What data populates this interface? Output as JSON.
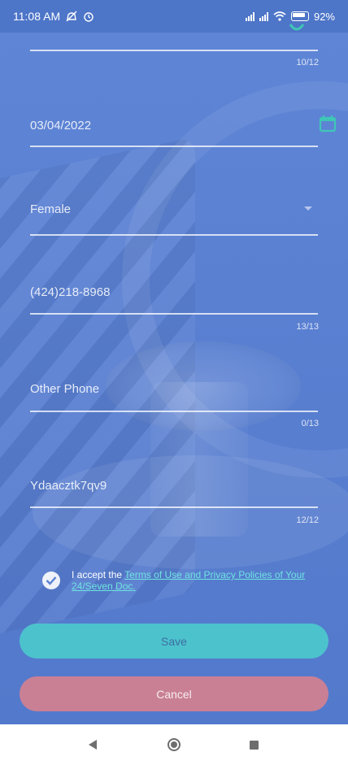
{
  "status_bar": {
    "time": "11:08 AM",
    "battery": "92%"
  },
  "form": {
    "top_field": {
      "counter": "10/12"
    },
    "date_field": {
      "value": "03/04/2022",
      "icon": "calendar-icon"
    },
    "gender_field": {
      "value": "Female",
      "icon": "dropdown-arrow-icon"
    },
    "phone_field": {
      "value": "(424)218-8968",
      "counter": "13/13"
    },
    "other_phone_field": {
      "placeholder": "Other Phone",
      "counter": "0/13"
    },
    "code_field": {
      "value": "Ydaacztk7qv9",
      "counter": "12/12"
    }
  },
  "terms": {
    "prefix": "I accept the ",
    "link_text": "Terms of Use and Privacy Policies of Your 24/Seven Doc.",
    "checked": true
  },
  "buttons": {
    "save_label": "Save",
    "cancel_label": "Cancel"
  },
  "colors": {
    "background": "#5a80d2",
    "accent_teal": "#4cc2cd",
    "cancel": "#c98095",
    "link": "#6fe3e0"
  }
}
